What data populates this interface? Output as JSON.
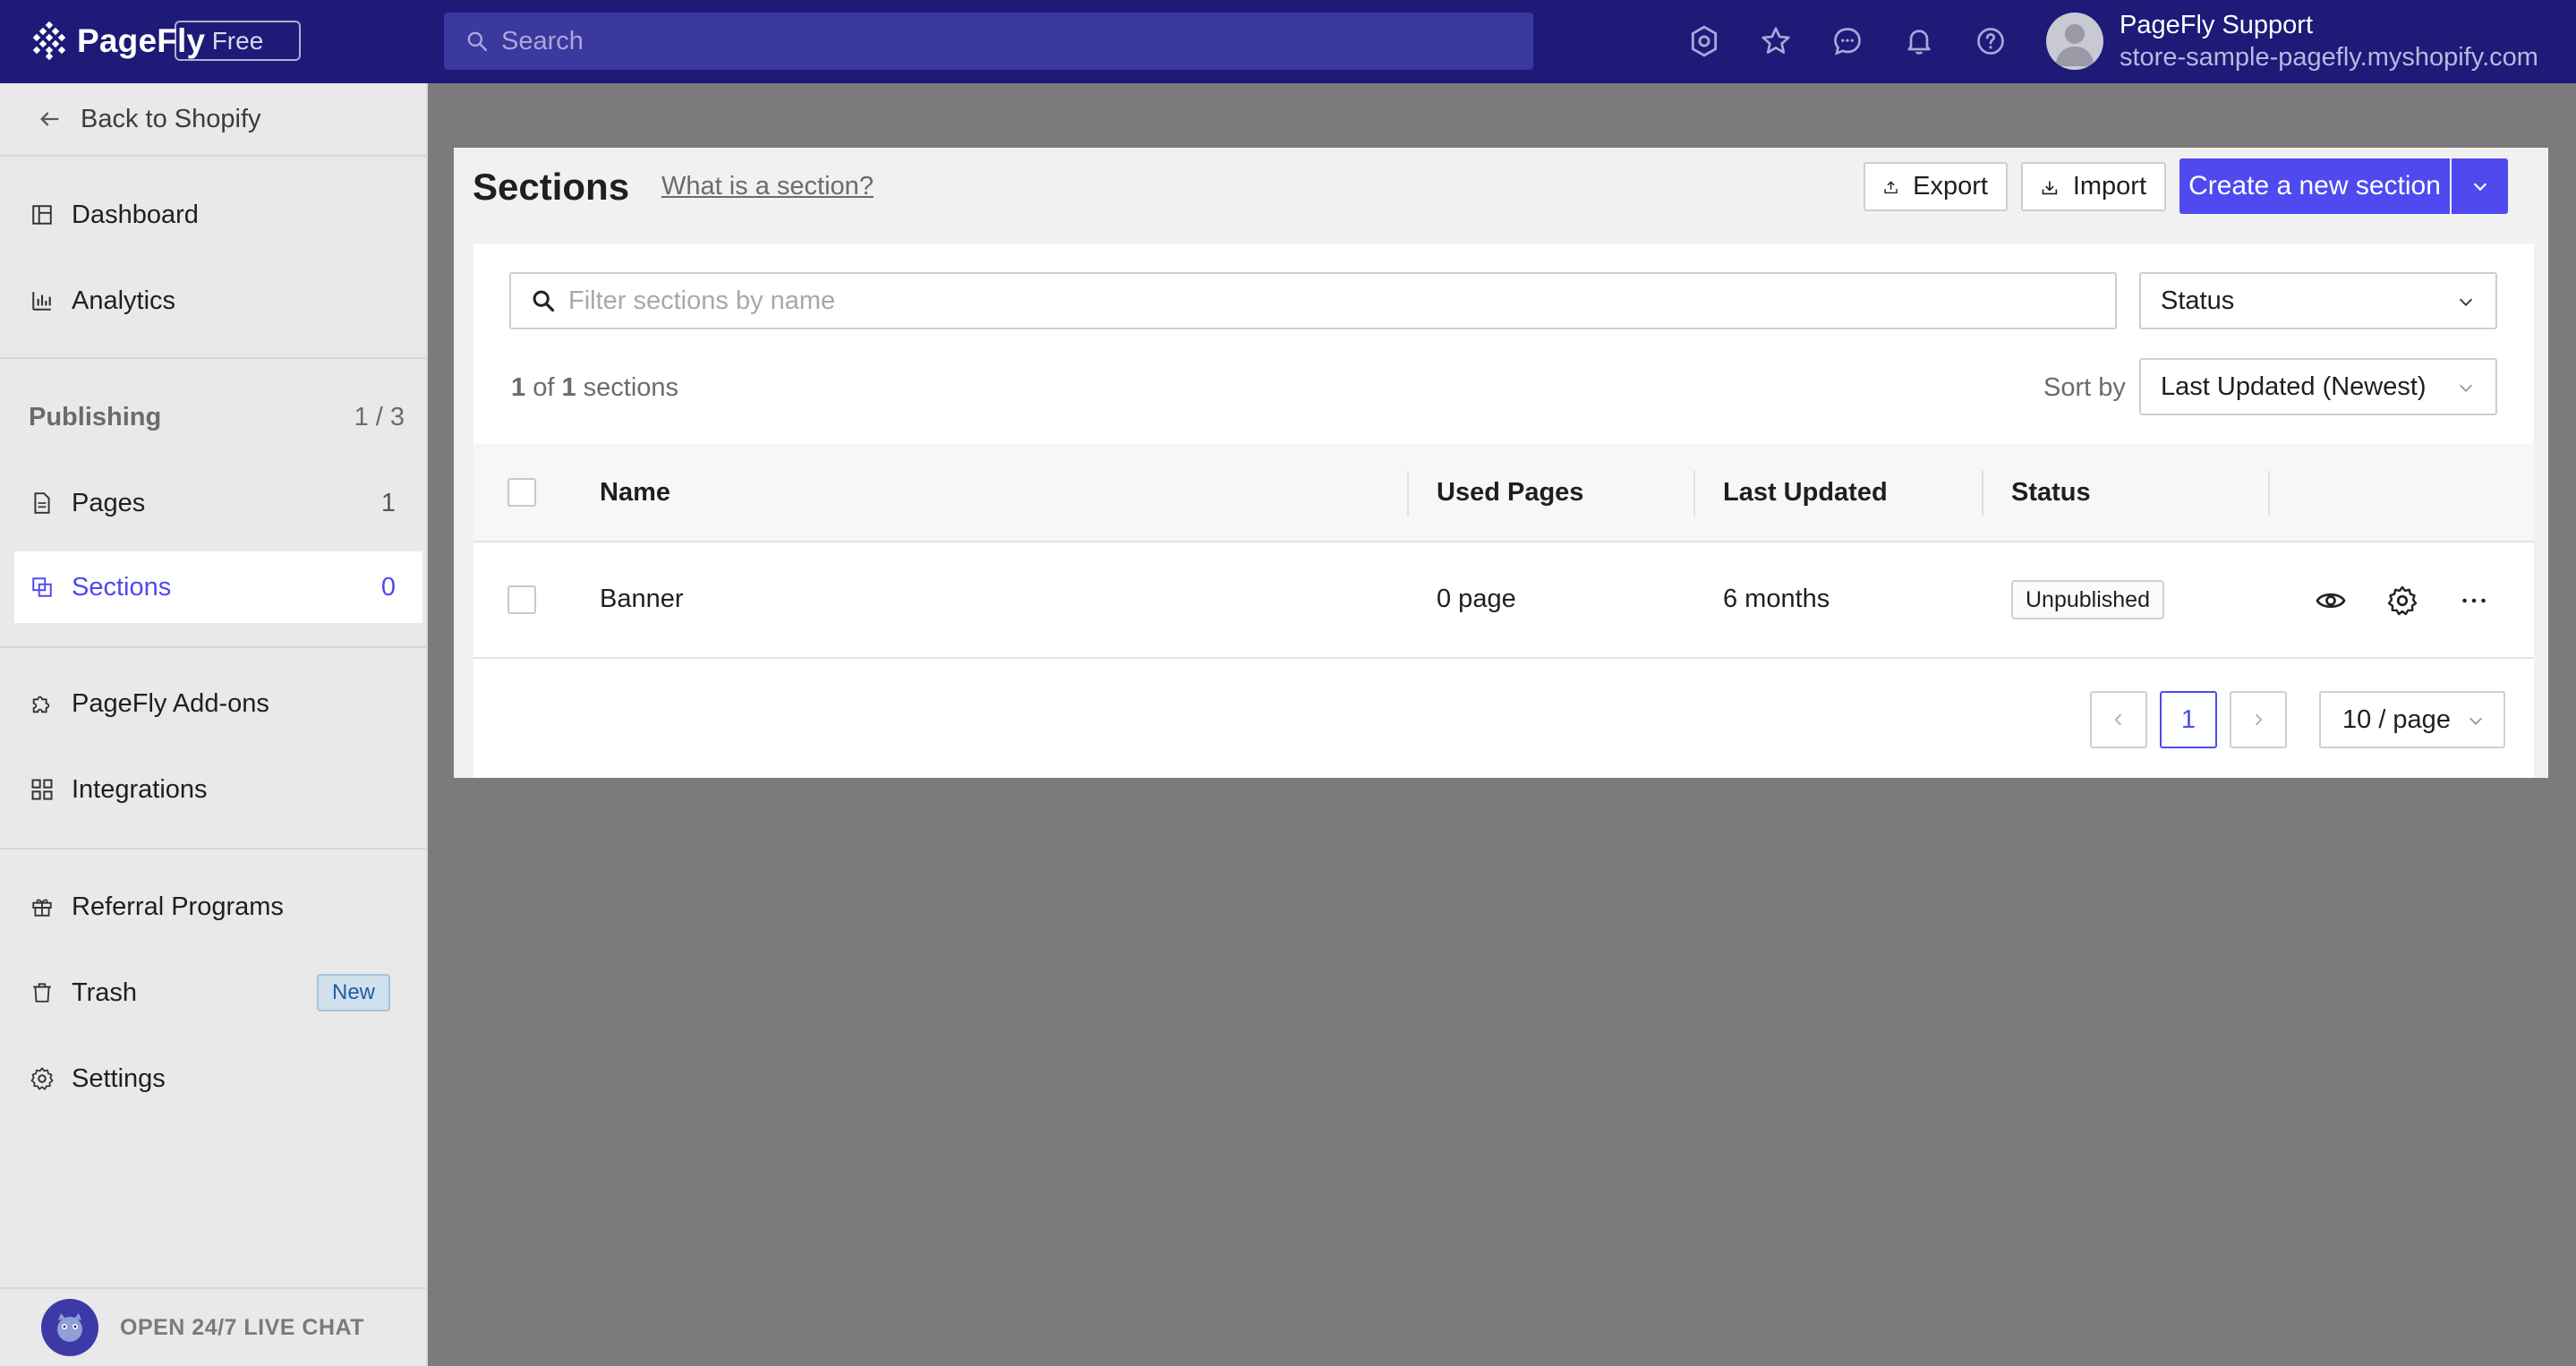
{
  "topbar": {
    "logo_text": "PageFly",
    "plan_badge": "Free",
    "search_placeholder": "Search",
    "user_name": "PageFly Support",
    "user_store": "store-sample-pagefly.myshopify.com",
    "icons": [
      "settings-icon",
      "star-icon",
      "chat-icon",
      "bell-icon",
      "help-icon"
    ]
  },
  "sidebar": {
    "back_label": "Back to Shopify",
    "items": [
      {
        "label": "Dashboard",
        "icon": "dashboard-icon"
      },
      {
        "label": "Analytics",
        "icon": "analytics-icon"
      }
    ],
    "publishing_group": {
      "label": "Publishing",
      "count": "1 / 3"
    },
    "publishing_items": [
      {
        "label": "Pages",
        "count": "1",
        "icon": "page-icon"
      },
      {
        "label": "Sections",
        "count": "0",
        "icon": "sections-icon",
        "active": true
      }
    ],
    "extras": [
      {
        "label": "PageFly Add-ons",
        "icon": "puzzle-icon"
      },
      {
        "label": "Integrations",
        "icon": "integrations-icon"
      }
    ],
    "bottom_items": [
      {
        "label": "Referral Programs",
        "icon": "gift-icon"
      },
      {
        "label": "Trash",
        "icon": "trash-icon",
        "badge": "New"
      },
      {
        "label": "Settings",
        "icon": "gear-icon"
      }
    ],
    "live_chat": "OPEN 24/7 LIVE CHAT"
  },
  "main": {
    "title": "Sections",
    "help_link": "What is a section?",
    "export_label": "Export",
    "import_label": "Import",
    "create_label": "Create a new section",
    "filter_placeholder": "Filter sections by name",
    "status_select": "Status",
    "count_current": "1",
    "count_of": "of",
    "count_total": "1",
    "count_unit": "sections",
    "sort_by_label": "Sort by",
    "sort_by_value": "Last Updated (Newest)",
    "columns": [
      "Name",
      "Used Pages",
      "Last Updated",
      "Status"
    ],
    "rows": [
      {
        "name": "Banner",
        "used_pages": "0 page",
        "last_updated": "6 months",
        "status": "Unpublished"
      }
    ],
    "pagination": {
      "current_page": "1",
      "per_page": "10 / page"
    }
  },
  "colors": {
    "topbar": "#1d1a78",
    "accent": "#4e4af0",
    "overlay": "#7b7b7c"
  }
}
